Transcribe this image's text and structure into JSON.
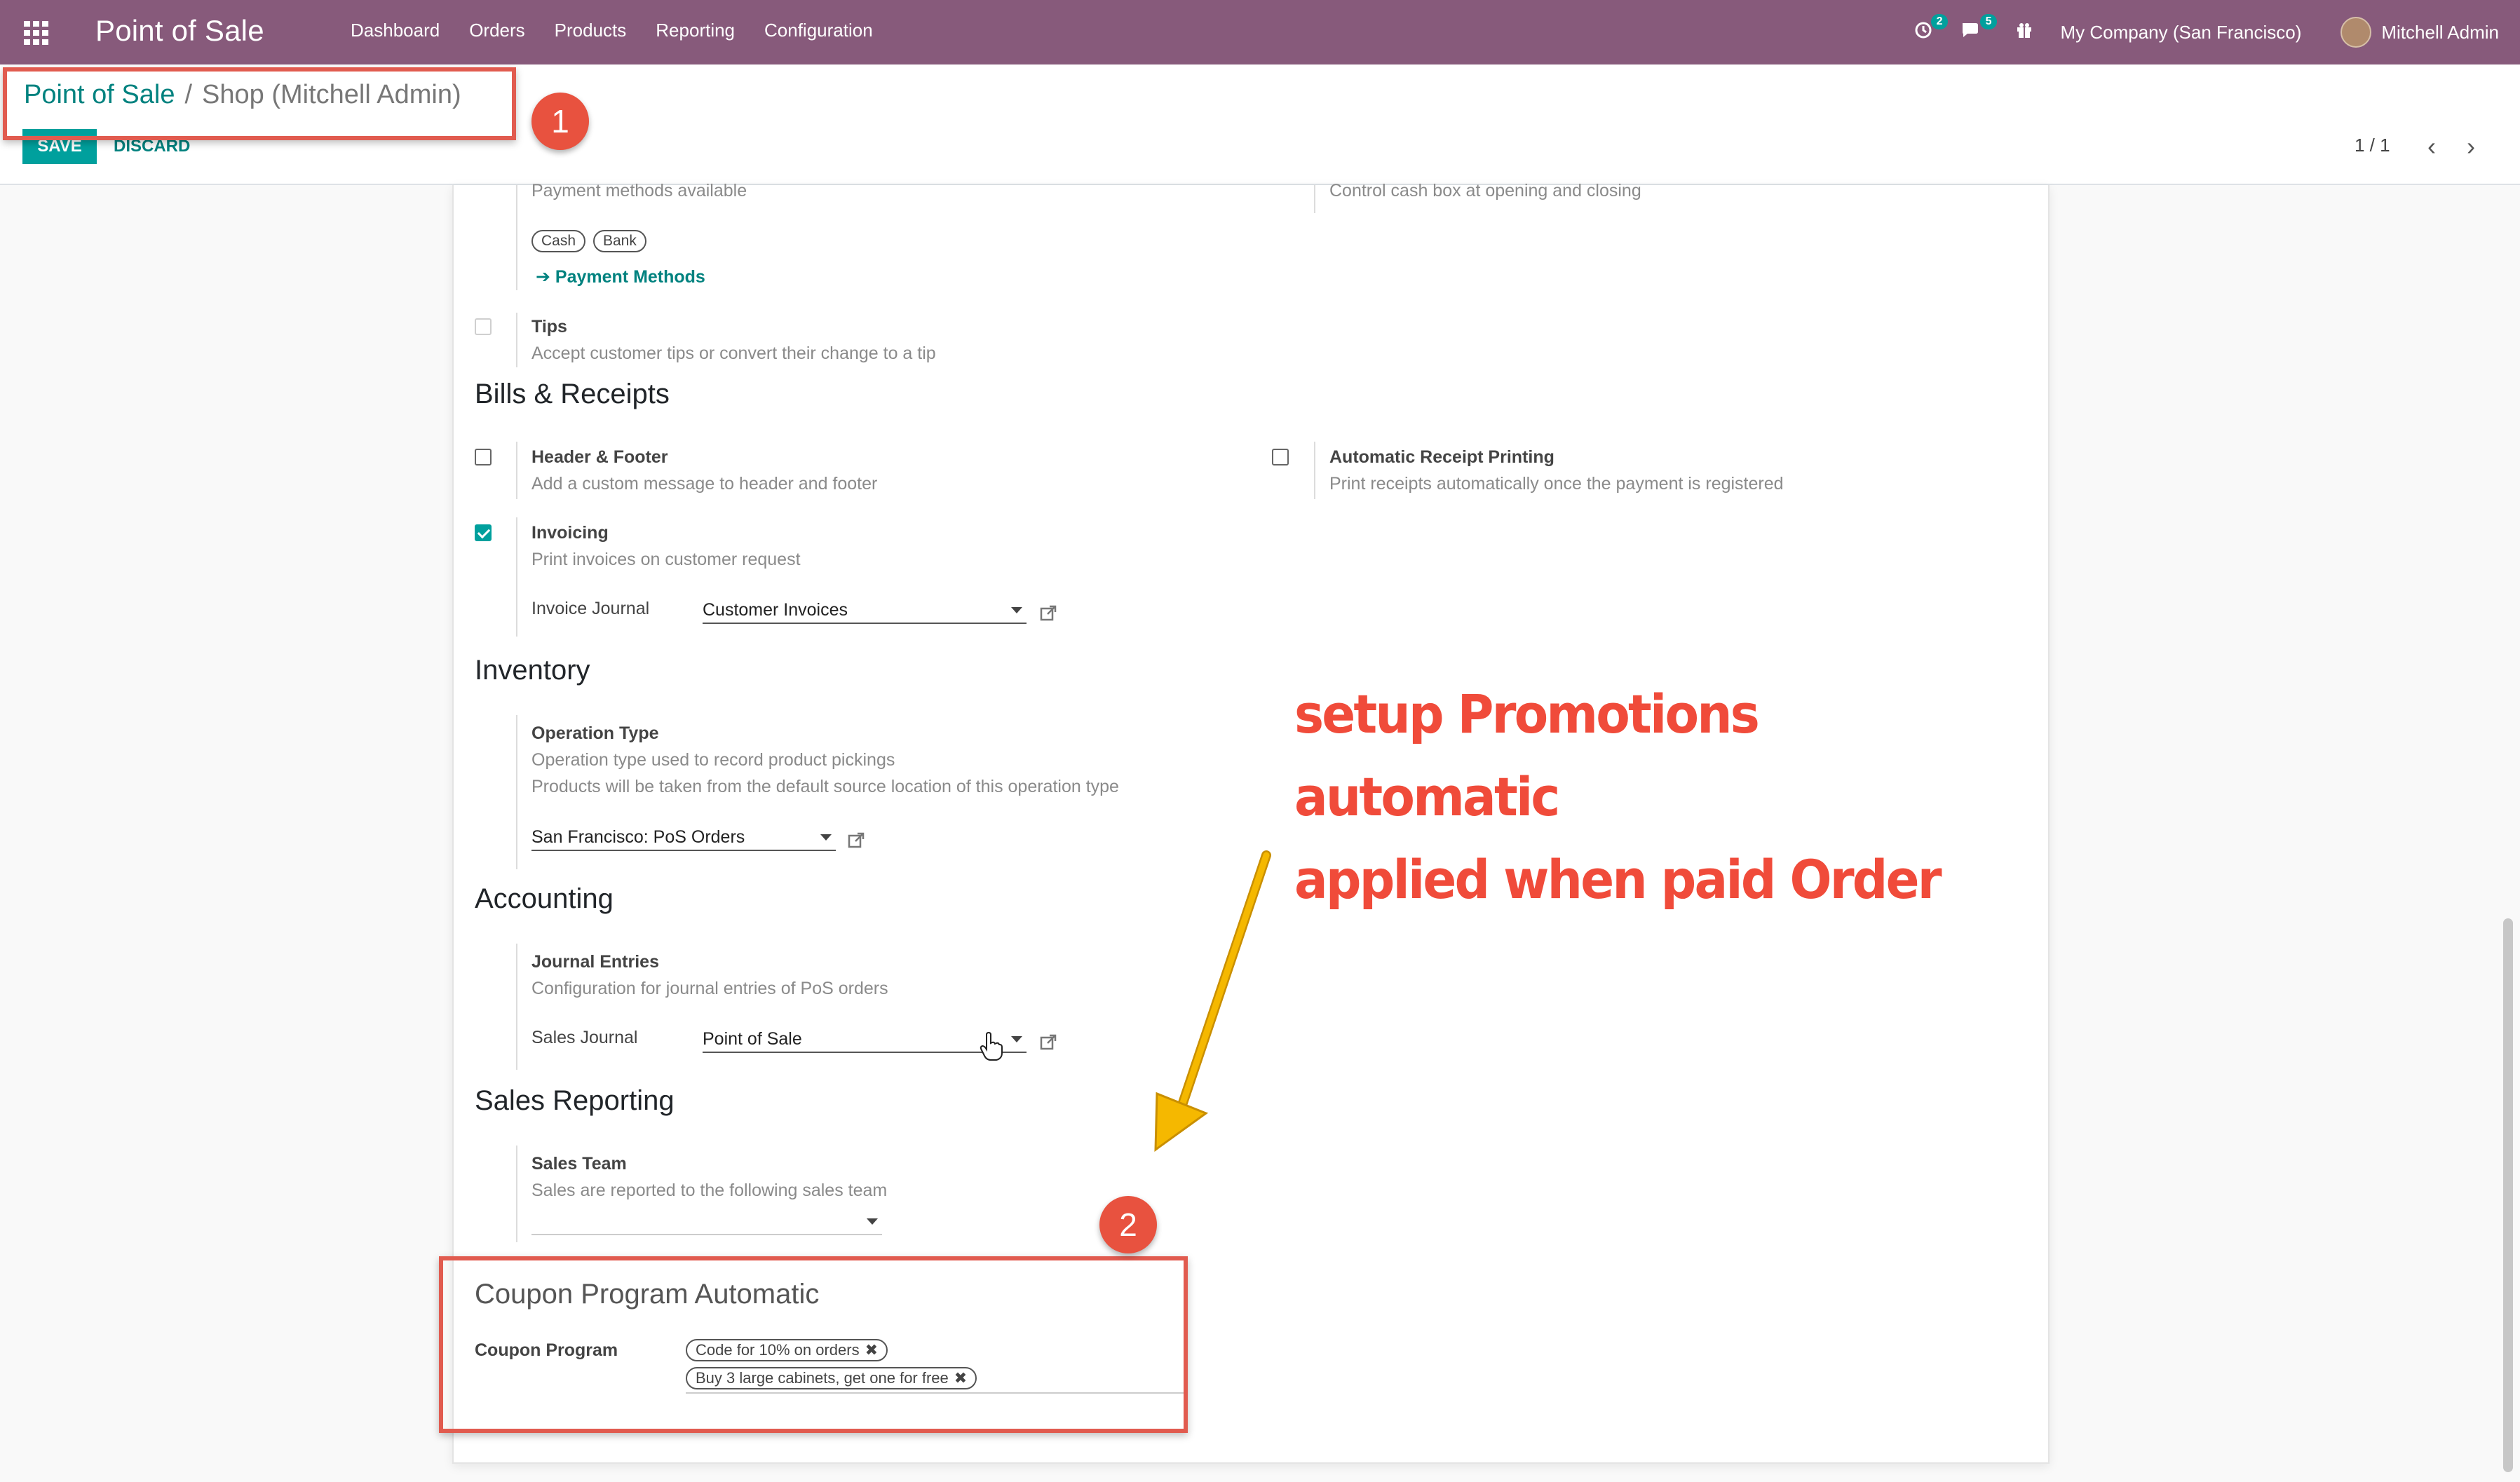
{
  "navbar": {
    "app_title": "Point of Sale",
    "menu": [
      "Dashboard",
      "Orders",
      "Products",
      "Reporting",
      "Configuration"
    ],
    "activity_count": "2",
    "messages_count": "5",
    "company": "My Company (San Francisco)",
    "user": "Mitchell Admin",
    "background_color": "#875a7b"
  },
  "breadcrumb": {
    "parent": "Point of Sale",
    "separator": "/",
    "current": "Shop (Mitchell Admin)"
  },
  "actions": {
    "save": "SAVE",
    "discard": "DISCARD"
  },
  "pager": {
    "value": "1 / 1",
    "prev": "‹",
    "next": "›"
  },
  "payments": {
    "description": "Payment methods available",
    "methods": [
      "Cash",
      "Bank"
    ],
    "link": "Payment Methods",
    "cash_control_description": "Control cash box at opening and closing"
  },
  "tips": {
    "label": "Tips",
    "description": "Accept customer tips or convert their change to a tip",
    "checked": false
  },
  "bills_receipts": {
    "title": "Bills & Receipts",
    "header_footer": {
      "label": "Header & Footer",
      "description": "Add a custom message to header and footer",
      "checked": false
    },
    "auto_receipt": {
      "label": "Automatic Receipt Printing",
      "description": "Print receipts automatically once the payment is registered",
      "checked": false
    },
    "invoicing": {
      "label": "Invoicing",
      "description": "Print invoices on customer request",
      "checked": true
    },
    "invoice_journal": {
      "label": "Invoice Journal",
      "value": "Customer Invoices"
    }
  },
  "inventory": {
    "title": "Inventory",
    "operation_type": {
      "label": "Operation Type",
      "description_1": "Operation type used to record product pickings",
      "description_2": "Products will be taken from the default source location of this operation type",
      "value": "San Francisco: PoS Orders"
    }
  },
  "accounting": {
    "title": "Accounting",
    "journal_entries": {
      "label": "Journal Entries",
      "description": "Configuration for journal entries of PoS orders"
    },
    "sales_journal": {
      "label": "Sales Journal",
      "value": "Point of Sale"
    }
  },
  "sales_reporting": {
    "title": "Sales Reporting",
    "sales_team": {
      "label": "Sales Team",
      "description": "Sales are reported to the following sales team",
      "value": ""
    }
  },
  "coupon": {
    "title": "Coupon Program Automatic",
    "label": "Coupon Program",
    "tags": [
      "Code for 10% on orders",
      "Buy 3 large cabinets, get one for free"
    ]
  },
  "annotations": {
    "step1": "1",
    "step2": "2",
    "note_line1": "setup Promotions automatic",
    "note_line2": "applied when paid Order",
    "note_color": "#f04b3a",
    "arrow_color": "#f5b800",
    "box_color": "#e15b4f"
  }
}
